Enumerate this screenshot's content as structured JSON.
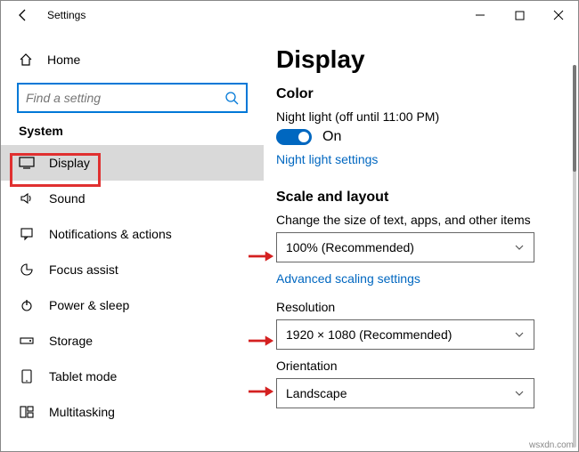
{
  "titlebar": {
    "title": "Settings"
  },
  "sidebar": {
    "home": "Home",
    "search_placeholder": "Find a setting",
    "group": "System",
    "items": [
      {
        "label": "Display"
      },
      {
        "label": "Sound"
      },
      {
        "label": "Notifications & actions"
      },
      {
        "label": "Focus assist"
      },
      {
        "label": "Power & sleep"
      },
      {
        "label": "Storage"
      },
      {
        "label": "Tablet mode"
      },
      {
        "label": "Multitasking"
      }
    ]
  },
  "content": {
    "page_title": "Display",
    "color": {
      "heading": "Color",
      "night_light_label": "Night light (off until 11:00 PM)",
      "toggle_text": "On",
      "night_light_link": "Night light settings"
    },
    "scale": {
      "heading": "Scale and layout",
      "text_size_label": "Change the size of text, apps, and other items",
      "text_size_value": "100% (Recommended)",
      "advanced_link": "Advanced scaling settings",
      "resolution_label": "Resolution",
      "resolution_value": "1920 × 1080 (Recommended)",
      "orientation_label": "Orientation",
      "orientation_value": "Landscape"
    }
  },
  "watermark": "wsxdn.com"
}
